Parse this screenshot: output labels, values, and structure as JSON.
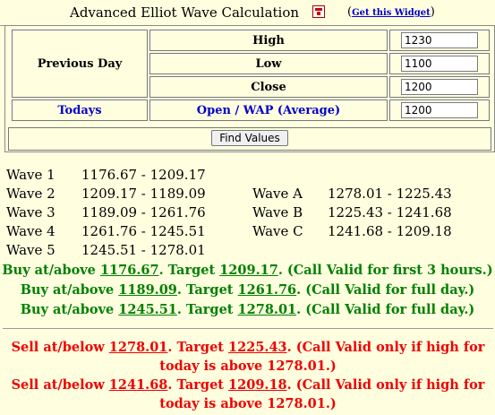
{
  "header": {
    "title": "Advanced Elliot Wave Calculation",
    "widget_icon": "widget-grid-icon",
    "get_widget_open": "(",
    "get_widget_link": "Get this Widget",
    "get_widget_close": ")"
  },
  "form": {
    "previous_day_label": "Previous Day",
    "high_label": "High",
    "low_label": "Low",
    "close_label": "Close",
    "todays_label": "Todays",
    "open_wap_label": "Open / WAP (Average)",
    "high_value": "1230",
    "low_value": "1100",
    "close_value": "1200",
    "open_value": "1200",
    "find_button": "Find Values"
  },
  "waves_left": [
    {
      "name": "Wave 1",
      "range": "1176.67 - 1209.17"
    },
    {
      "name": "Wave 2",
      "range": "1209.17 - 1189.09"
    },
    {
      "name": "Wave 3",
      "range": "1189.09 - 1261.76"
    },
    {
      "name": "Wave 4",
      "range": "1261.76 - 1245.51"
    },
    {
      "name": "Wave 5",
      "range": "1245.51 - 1278.01"
    }
  ],
  "waves_right": [
    {
      "name": "Wave A",
      "range": "1278.01 - 1225.43"
    },
    {
      "name": "Wave B",
      "range": "1225.43 - 1241.68"
    },
    {
      "name": "Wave C",
      "range": "1241.68 - 1209.18"
    }
  ],
  "buy_calls": [
    {
      "prefix": "Buy at/above ",
      "level": "1176.67",
      "mid": ". Target ",
      "target": "1209.17",
      "suffix": ". (Call Valid for first 3 hours.)"
    },
    {
      "prefix": "Buy at/above ",
      "level": "1189.09",
      "mid": ". Target ",
      "target": "1261.76",
      "suffix": ". (Call Valid for full day.)"
    },
    {
      "prefix": "Buy at/above ",
      "level": "1245.51",
      "mid": ". Target ",
      "target": "1278.01",
      "suffix": ". (Call Valid for full day.)"
    }
  ],
  "sell_calls": [
    {
      "prefix": "Sell at/below ",
      "level": "1278.01",
      "mid": ". Target ",
      "target": "1225.43",
      "suffix": ". (Call Valid only if high for",
      "line2": "today is above 1278.01.)"
    },
    {
      "prefix": "Sell at/below ",
      "level": "1241.68",
      "mid": ". Target ",
      "target": "1209.18",
      "suffix": ". (Call Valid only if high for",
      "line2": "today is above 1278.01.)"
    }
  ],
  "colors": {
    "background": "#ffffe0",
    "buy": "#008000",
    "sell": "#ee0000",
    "link": "#0000cc"
  }
}
